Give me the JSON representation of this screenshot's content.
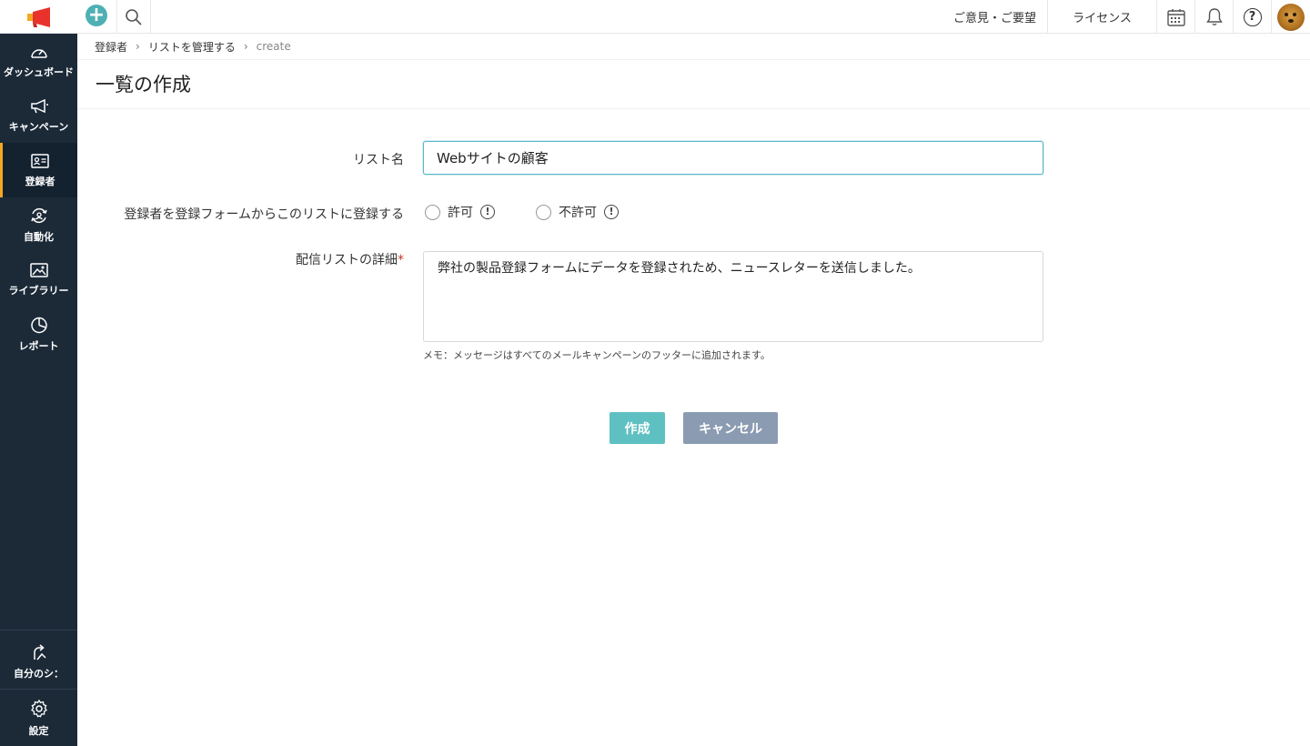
{
  "topbar": {
    "feedback_label": "ご意見・ご要望",
    "license_label": "ライセンス",
    "help_glyph": "?"
  },
  "sidebar": {
    "items": [
      {
        "label": "ダッシュボード",
        "icon": "dashboard-icon"
      },
      {
        "label": "キャンペーン",
        "icon": "megaphone-icon"
      },
      {
        "label": "登録者",
        "icon": "contact-card-icon",
        "active": true
      },
      {
        "label": "自動化",
        "icon": "automation-icon"
      },
      {
        "label": "ライブラリー",
        "icon": "image-icon"
      },
      {
        "label": "レポート",
        "icon": "pie-chart-icon"
      }
    ],
    "bottom_items": [
      {
        "label": "自分のシ：",
        "icon": "signal-icon"
      },
      {
        "label": "設定",
        "icon": "gear-icon"
      }
    ]
  },
  "breadcrumb": {
    "items": [
      "登録者",
      "リストを管理する",
      "create"
    ],
    "separator": "›"
  },
  "page": {
    "title": "一覧の作成"
  },
  "form": {
    "list_name_label": "リスト名",
    "list_name_value": "Webサイトの顧客",
    "signup_label": "登録者を登録フォームからこのリストに登録する",
    "radio_allow": "許可",
    "radio_deny": "不許可",
    "info_glyph": "!",
    "description_label": "配信リストの詳細",
    "required_mark": "*",
    "description_value": "弊社の製品登録フォームにデータを登録されため、ニュースレターを送信しました。",
    "memo": "メモ：メッセージはすべてのメールキャンペーンのフッターに追加されます。"
  },
  "buttons": {
    "create": "作成",
    "cancel": "キャンセル"
  },
  "colors": {
    "sidebar_bg": "#1c2a38",
    "active_indicator": "#f5a623",
    "accent": "#5fc0c2",
    "cancel_bg": "#8b9bb1",
    "input_focus": "#56b7c7",
    "logo_red": "#e8322b"
  }
}
